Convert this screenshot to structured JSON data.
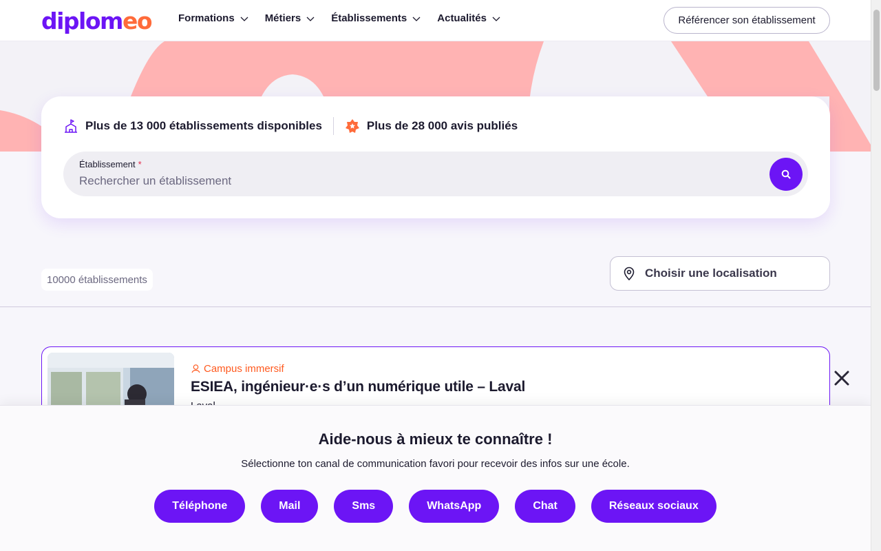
{
  "header": {
    "logo_text": "diplomeo",
    "nav": [
      {
        "label": "Formations"
      },
      {
        "label": "Métiers"
      },
      {
        "label": "Établissements"
      },
      {
        "label": "Actualités"
      }
    ],
    "cta_label": "Référencer son établissement"
  },
  "search": {
    "stat_establishments": "Plus de 13 000 établissements disponibles",
    "stat_reviews": "Plus de 28 000 avis publiés",
    "field_label": "Établissement",
    "required_mark": "*",
    "placeholder": "Rechercher un établissement"
  },
  "results": {
    "count_label": "10000 établissements",
    "location_label": "Choisir une localisation",
    "items": [
      {
        "tag": "Campus immersif",
        "title": "ESIEA, ingénieur·e·s d’un numérique utile – Laval",
        "city": "Laval"
      }
    ]
  },
  "preference_prompt": {
    "title": "Aide-nous à mieux te connaître !",
    "subtitle": "Sélectionne ton canal de communication favori pour recevoir des infos sur une école.",
    "channels": [
      "Téléphone",
      "Mail",
      "Sms",
      "WhatsApp",
      "Chat",
      "Réseaux sociaux"
    ]
  },
  "colors": {
    "brand": "#6c15f5",
    "accent": "#ff6b3a",
    "hero_shape": "#ffb3b3"
  }
}
